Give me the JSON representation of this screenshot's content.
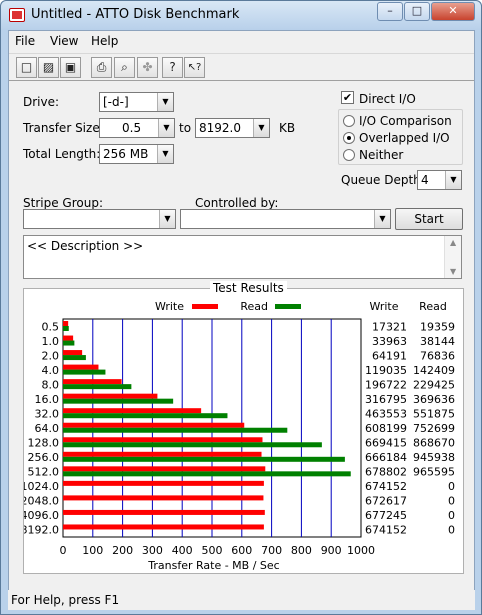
{
  "window": {
    "title": "Untitled - ATTO Disk Benchmark",
    "minimize_label": "–",
    "maximize_label": "□",
    "close_label": "✕"
  },
  "menu": {
    "file": "File",
    "view": "View",
    "help": "Help"
  },
  "toolbar": {
    "icons": [
      "new-icon",
      "open-icon",
      "save-icon",
      "print-icon",
      "print-preview-icon",
      "move-icon",
      "help-icon",
      "context-help-icon"
    ],
    "glyphs": [
      "□",
      "▨",
      "▣",
      "⎙",
      "⌕",
      "✤",
      "?",
      "↖?"
    ]
  },
  "settings": {
    "drive_label": "Drive:",
    "drive_value": "[-d-]",
    "transfer_size_label": "Transfer Size:",
    "transfer_from": "0.5",
    "transfer_to_label": "to",
    "transfer_to": "8192.0",
    "transfer_unit": "KB",
    "total_length_label": "Total Length:",
    "total_length_value": "256 MB",
    "direct_io_label": "Direct I/O",
    "direct_io_checked": true,
    "io_comparison_label": "I/O Comparison",
    "overlapped_io_label": "Overlapped I/O",
    "neither_label": "Neither",
    "selected_mode": "Overlapped I/O",
    "queue_depth_label": "Queue Depth:",
    "queue_depth_value": "4",
    "stripe_group_label": "Stripe Group:",
    "stripe_group_value": "",
    "controlled_by_label": "Controlled by:",
    "controlled_by_value": "",
    "start_label": "Start",
    "description_text": "<< Description >>",
    "check_mark": "✔",
    "dropdown_arrow": "▼",
    "scroll_up": "▲",
    "scroll_down": "▼"
  },
  "results": {
    "title": "Test Results",
    "legend_write": "Write",
    "legend_read": "Read",
    "col_write": "Write",
    "col_read": "Read",
    "write_color": "#ff0000",
    "read_color": "#008000",
    "grid_color": "#0000c0"
  },
  "chart_data": {
    "type": "bar",
    "categories": [
      "0.5",
      "1.0",
      "2.0",
      "4.0",
      "8.0",
      "16.0",
      "32.0",
      "64.0",
      "128.0",
      "256.0",
      "512.0",
      "1024.0",
      "2048.0",
      "4096.0",
      "8192.0"
    ],
    "series": [
      {
        "name": "Write",
        "values": [
          17321,
          33963,
          64191,
          119035,
          196722,
          316795,
          463553,
          608199,
          669415,
          666184,
          678802,
          674152,
          672617,
          677245,
          674152
        ]
      },
      {
        "name": "Read",
        "values": [
          19359,
          38144,
          76836,
          142409,
          229425,
          369636,
          551875,
          752699,
          868670,
          945938,
          965595,
          0,
          0,
          0,
          0
        ]
      }
    ],
    "xlabel": "Transfer Rate - MB / Sec",
    "xlim": [
      0,
      1000
    ],
    "xticks": [
      "0",
      "100",
      "200",
      "300",
      "400",
      "500",
      "600",
      "700",
      "800",
      "900",
      "1000"
    ]
  },
  "status": {
    "text": "For Help, press F1"
  }
}
